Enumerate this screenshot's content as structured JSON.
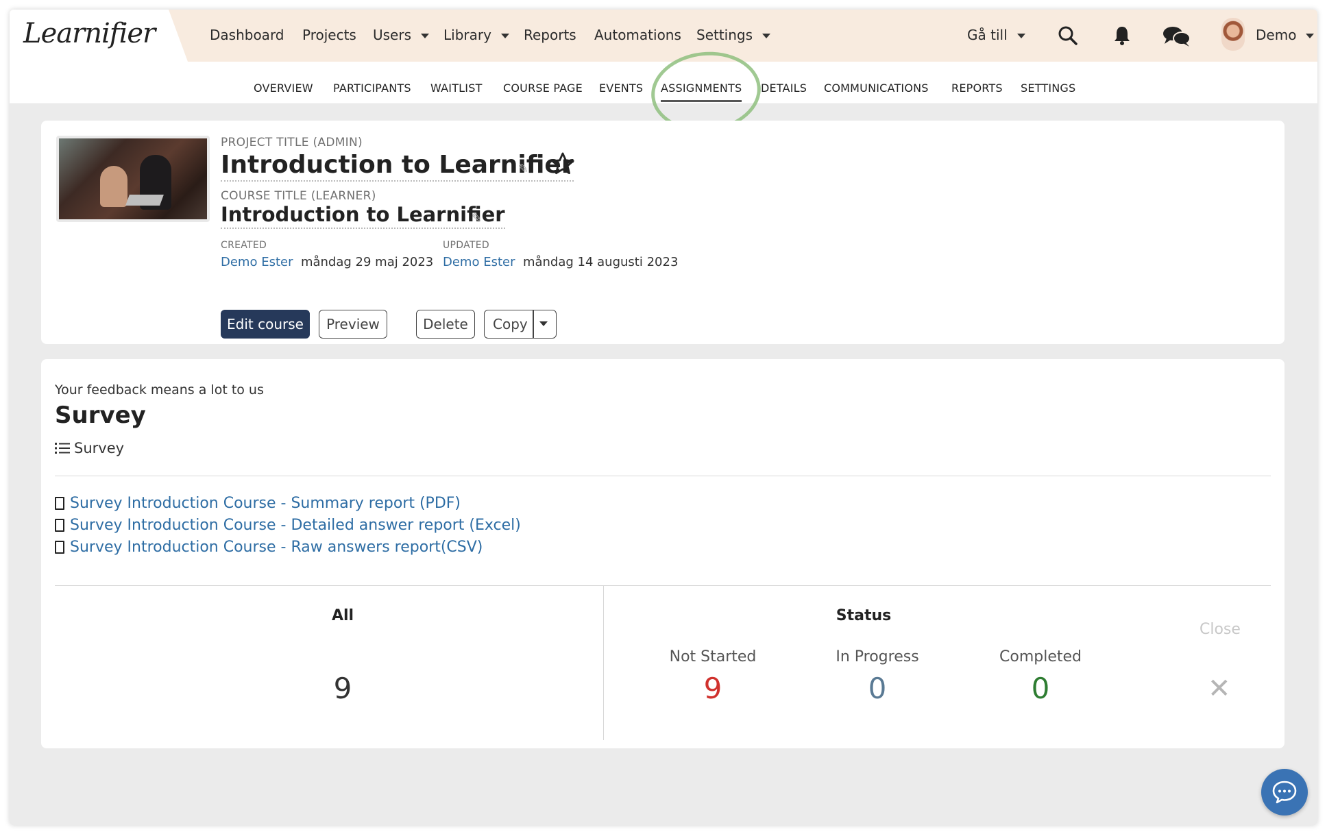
{
  "app": {
    "logo": "Learnifier"
  },
  "topnav": {
    "items": [
      {
        "label": "Dashboard"
      },
      {
        "label": "Projects"
      },
      {
        "label": "Users"
      },
      {
        "label": "Library"
      },
      {
        "label": "Reports"
      },
      {
        "label": "Automations"
      },
      {
        "label": "Settings"
      }
    ],
    "goto_label": "Gå till",
    "user_label": "Demo"
  },
  "subnav": {
    "items": [
      {
        "label": "OVERVIEW"
      },
      {
        "label": "PARTICIPANTS"
      },
      {
        "label": "WAITLIST"
      },
      {
        "label": "COURSE PAGE"
      },
      {
        "label": "EVENTS"
      },
      {
        "label": "ASSIGNMENTS"
      },
      {
        "label": "DETAILS"
      },
      {
        "label": "COMMUNICATIONS"
      },
      {
        "label": "REPORTS"
      },
      {
        "label": "SETTINGS"
      }
    ],
    "active": "ASSIGNMENTS"
  },
  "project": {
    "project_title_label": "PROJECT TITLE (ADMIN)",
    "project_title": "Introduction to Learnifier",
    "course_title_label": "COURSE TITLE (LEARNER)",
    "course_title": "Introduction to Learnifier",
    "created_label": "CREATED",
    "created_by": "Demo Ester",
    "created_date": "måndag 29 maj 2023",
    "updated_label": "UPDATED",
    "updated_by": "Demo Ester",
    "updated_date": "måndag 14 augusti 2023",
    "buttons": {
      "edit": "Edit course",
      "preview": "Preview",
      "delete": "Delete",
      "copy": "Copy"
    }
  },
  "survey": {
    "subtitle": "Your feedback means a lot to us",
    "title": "Survey",
    "type_label": "Survey",
    "reports": [
      {
        "label": "Survey Introduction Course - Summary report (PDF)"
      },
      {
        "label": "Survey Introduction Course - Detailed answer report (Excel)"
      },
      {
        "label": "Survey Introduction Course - Raw answers report(CSV)"
      }
    ],
    "stats": {
      "all_label": "All",
      "all_value": "9",
      "status_label": "Status",
      "not_started_label": "Not Started",
      "not_started_value": "9",
      "in_progress_label": "In Progress",
      "in_progress_value": "0",
      "completed_label": "Completed",
      "completed_value": "0",
      "close_label": "Close"
    }
  },
  "colors": {
    "topbar_bg": "#f8ebdf",
    "primary_button": "#26395a",
    "link": "#2e6da4",
    "not_started": "#d0312d",
    "in_progress": "#5a7a94",
    "completed": "#2e7d32",
    "annotation_circle": "#8fbf7f"
  }
}
